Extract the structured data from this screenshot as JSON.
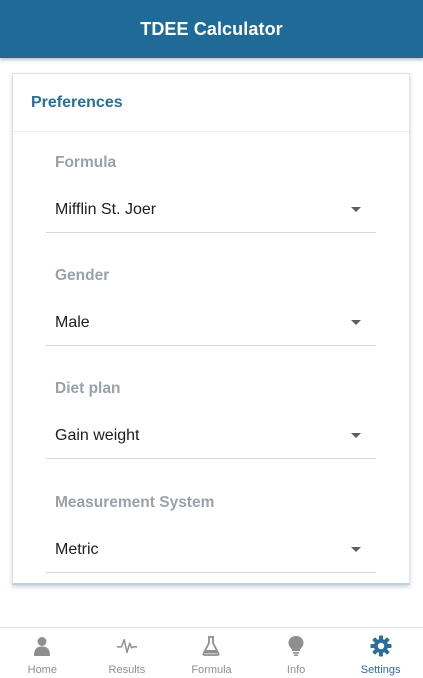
{
  "app": {
    "title": "TDEE Calculator"
  },
  "card": {
    "title": "Preferences"
  },
  "preferences": [
    {
      "label": "Formula",
      "value": "Mifflin St. Joer"
    },
    {
      "label": "Gender",
      "value": "Male"
    },
    {
      "label": "Diet plan",
      "value": "Gain weight"
    },
    {
      "label": "Measurement System",
      "value": "Metric"
    }
  ],
  "nav": {
    "items": [
      {
        "label": "Home",
        "icon": "person-icon"
      },
      {
        "label": "Results",
        "icon": "pulse-icon"
      },
      {
        "label": "Formula",
        "icon": "flask-icon"
      },
      {
        "label": "Info",
        "icon": "lightbulb-icon"
      },
      {
        "label": "Settings",
        "icon": "gear-icon",
        "active": true
      }
    ]
  },
  "colors": {
    "header": "#1f6a97",
    "accent": "#2b6e99",
    "label_gray": "#9aa1a8",
    "icon_gray": "#8f8f8f"
  }
}
